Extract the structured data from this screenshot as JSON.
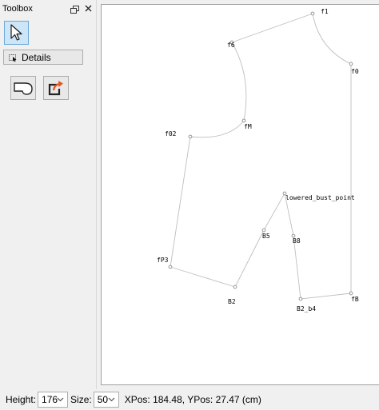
{
  "toolbox": {
    "title": "Toolbox",
    "details_label": "Details"
  },
  "statusbar": {
    "height_label": "Height:",
    "height_value": "176",
    "size_label": "Size:",
    "size_value": "50",
    "position_text": "XPos: 184.48, YPos: 27.47 (cm)"
  },
  "points": [
    {
      "id": "f1",
      "label": "f1"
    },
    {
      "id": "f6",
      "label": "f6"
    },
    {
      "id": "f0",
      "label": "f0"
    },
    {
      "id": "fM",
      "label": "fM"
    },
    {
      "id": "f02",
      "label": "f02"
    },
    {
      "id": "lowered_bust_point",
      "label": "lowered_bust_point"
    },
    {
      "id": "B5",
      "label": "B5"
    },
    {
      "id": "B8",
      "label": "B8"
    },
    {
      "id": "fP3",
      "label": "fP3"
    },
    {
      "id": "B2",
      "label": "B2"
    },
    {
      "id": "B2_b4",
      "label": "B2_b4"
    },
    {
      "id": "fB",
      "label": "fB"
    }
  ],
  "colors": {
    "line": "#bfbfbf",
    "point": "#8a8a8a",
    "selected_tool": "#cde6f7",
    "accent": "#e8541e"
  }
}
